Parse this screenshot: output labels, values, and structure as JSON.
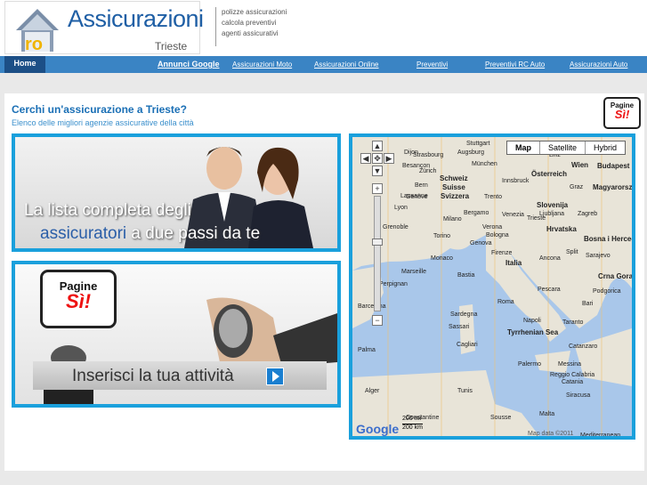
{
  "header": {
    "logo_text": "Assicurazioni",
    "logo_subtext": "Trieste",
    "taglines": [
      "polizze assicurazioni",
      "calcola preventivi",
      "agenti assicurativi"
    ]
  },
  "nav": {
    "home": "Home",
    "annunci_google": "Annunci Google",
    "links": [
      "Assicurazioni Moto",
      "Assicurazioni Online",
      "Preventivi",
      "Preventivi RC Auto",
      "Assicurazioni Auto"
    ]
  },
  "main": {
    "title": "Cerchi un'assicurazione a Trieste?",
    "subtitle": "Elenco delle migliori agenzie assicurative della città",
    "paginesi_line1": "Pagine",
    "paginesi_line2": "Sì!",
    "banner1_line1": "La lista completa degli",
    "banner1_line2_highlight": "assicuratori",
    "banner1_line2_rest": " a due passi da te",
    "banner2_text": "Inserisci la tua attività"
  },
  "map": {
    "types": [
      "Map",
      "Satellite",
      "Hybrid"
    ],
    "selected": "Map",
    "scale_top": "200 mi",
    "scale_bottom": "200 km",
    "google": "Google",
    "map_data": "Map data ©2011",
    "cities": [
      "Stuttgart",
      "Augsburg",
      "München",
      "Strasbourg",
      "Linz",
      "Wien",
      "Budapest",
      "Österreich",
      "Schweiz",
      "Suisse",
      "Svizzera",
      "Zürich",
      "Bern",
      "Innsbruck",
      "Graz",
      "Magyarország",
      "Slovenija",
      "Ljubljana",
      "Zagreb",
      "Hrvatska",
      "Lyon",
      "Genève",
      "Milano",
      "Venezia",
      "Torino",
      "Genova",
      "Bologna",
      "Monaco",
      "Italia",
      "Firenze",
      "Ancona",
      "Bosna i Hercegovina",
      "Marseille",
      "Perpignan",
      "Barcelona",
      "Roma",
      "Napoli",
      "Bari",
      "Crna Gora",
      "Sardegna",
      "Cagliari",
      "Tyrrhenian Sea",
      "Palermo",
      "Messina",
      "Catania",
      "Palma",
      "Alger",
      "Tunis",
      "Sousse",
      "Malta",
      "Mediterranean",
      "Constantine",
      "Dijon",
      "Besançon",
      "Lausanne",
      "Trento",
      "Verona",
      "Bergamo",
      "Trieste",
      "Split",
      "Pescara",
      "Podgorica",
      "Sarajevo",
      "Sassari",
      "Bastia",
      "Grenoble",
      "Siracusa",
      "Reggio Calabria",
      "Taranto",
      "Catanzaro"
    ]
  }
}
